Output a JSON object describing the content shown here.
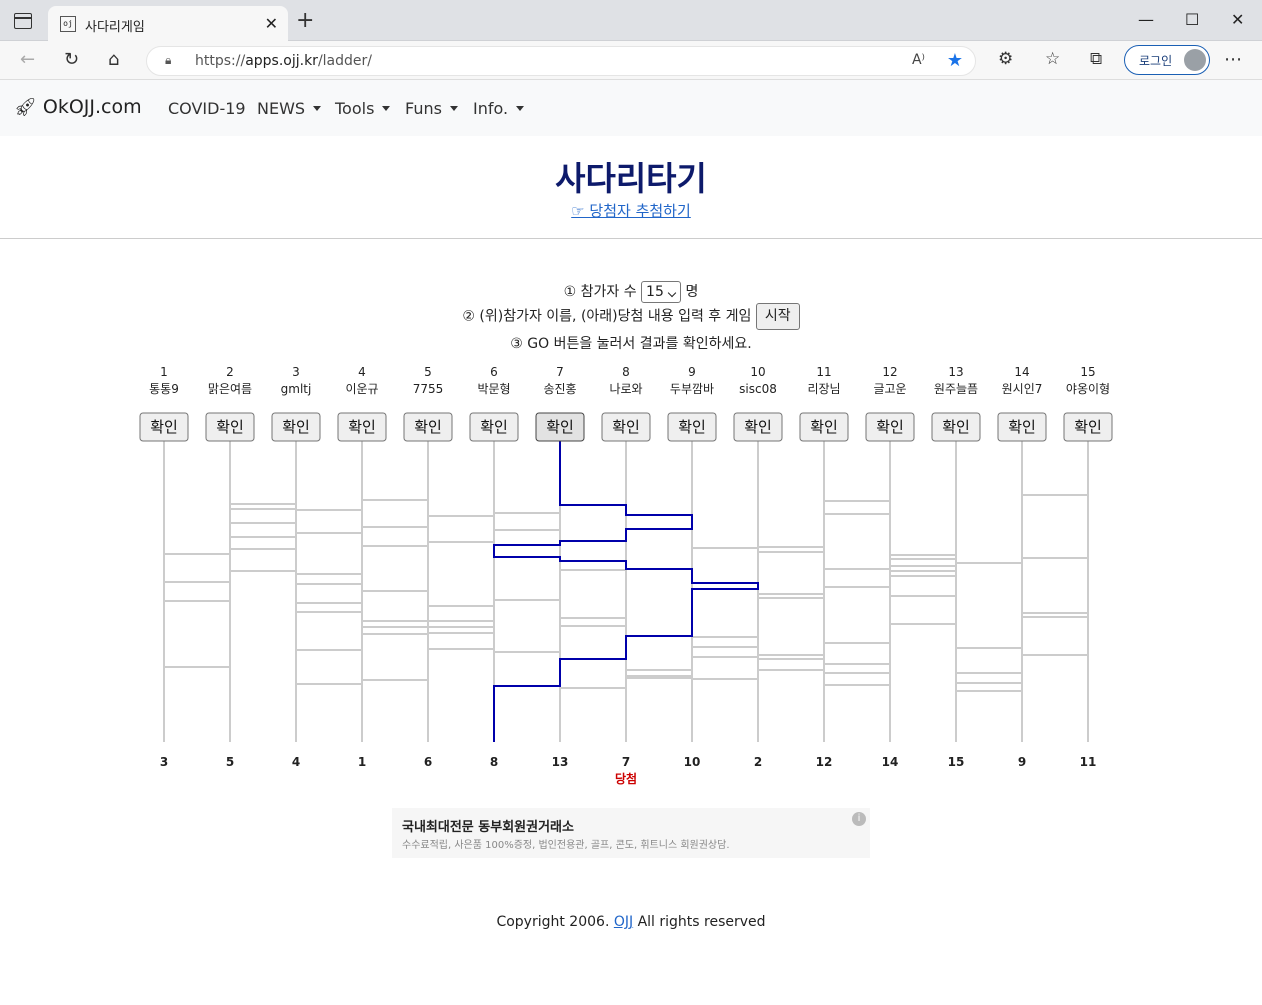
{
  "browser": {
    "tab_title": "사다리게임",
    "url_prefix": "https://",
    "url_host": "apps.ojj.kr",
    "url_path": "/ladder/",
    "login_label": "로그인"
  },
  "nav": {
    "brand": "OkOJJ.com",
    "items": [
      "COVID-19",
      "NEWS",
      "Tools",
      "Funs",
      "Info."
    ]
  },
  "header": {
    "title": "사다리타기",
    "draw_link": "☞ 당첨자 추첨하기"
  },
  "steps": {
    "step1_prefix": "① 참가자 수",
    "participant_count": "15",
    "step1_suffix": "명",
    "step2": "② (위)참가자 이름, (아래)당첨 내용 입력 후 게임",
    "start_label": "시작",
    "step3": "③ GO 버튼을 눌러서 결과를 확인하세요."
  },
  "players": [
    {
      "no": "1",
      "name": "통통9"
    },
    {
      "no": "2",
      "name": "맑은여름"
    },
    {
      "no": "3",
      "name": "gmltj"
    },
    {
      "no": "4",
      "name": "이운규"
    },
    {
      "no": "5",
      "name": "7755"
    },
    {
      "no": "6",
      "name": "박문형"
    },
    {
      "no": "7",
      "name": "송진홍"
    },
    {
      "no": "8",
      "name": "나로와"
    },
    {
      "no": "9",
      "name": "두부깜바"
    },
    {
      "no": "10",
      "name": "sisc08"
    },
    {
      "no": "11",
      "name": "리장님"
    },
    {
      "no": "12",
      "name": "글고운"
    },
    {
      "no": "13",
      "name": "원주늘픔"
    },
    {
      "no": "14",
      "name": "원시인7"
    },
    {
      "no": "15",
      "name": "야옹이형"
    }
  ],
  "confirm_label": "확인",
  "results": [
    "3",
    "5",
    "4",
    "1",
    "6",
    "8",
    "13",
    "7",
    "10",
    "2",
    "12",
    "14",
    "15",
    "9",
    "11"
  ],
  "winner_label": "당첨",
  "ladder": {
    "rungs": [
      [
        0,
        554
      ],
      [
        0,
        582
      ],
      [
        0,
        601
      ],
      [
        0,
        667
      ],
      [
        1,
        504
      ],
      [
        1,
        509
      ],
      [
        1,
        523
      ],
      [
        1,
        537
      ],
      [
        1,
        549
      ],
      [
        1,
        571
      ],
      [
        2,
        510
      ],
      [
        2,
        533
      ],
      [
        2,
        574
      ],
      [
        2,
        584
      ],
      [
        2,
        603
      ],
      [
        2,
        612
      ],
      [
        2,
        650
      ],
      [
        2,
        684
      ],
      [
        3,
        500
      ],
      [
        3,
        527
      ],
      [
        3,
        546
      ],
      [
        3,
        591
      ],
      [
        3,
        621
      ],
      [
        3,
        627
      ],
      [
        3,
        634
      ],
      [
        3,
        680
      ],
      [
        4,
        516
      ],
      [
        4,
        542
      ],
      [
        4,
        606
      ],
      [
        4,
        621
      ],
      [
        4,
        627
      ],
      [
        4,
        633
      ],
      [
        4,
        649
      ],
      [
        5,
        513
      ],
      [
        5,
        530
      ],
      [
        5,
        545
      ],
      [
        5,
        557
      ],
      [
        5,
        600
      ],
      [
        5,
        652
      ],
      [
        5,
        686
      ],
      [
        6,
        505
      ],
      [
        6,
        541
      ],
      [
        6,
        561
      ],
      [
        6,
        570
      ],
      [
        6,
        618
      ],
      [
        6,
        626
      ],
      [
        6,
        659
      ],
      [
        6,
        688
      ],
      [
        7,
        515
      ],
      [
        7,
        529
      ],
      [
        7,
        569
      ],
      [
        7,
        636
      ],
      [
        7,
        670
      ],
      [
        7,
        676
      ],
      [
        7,
        678
      ],
      [
        8,
        548
      ],
      [
        8,
        583
      ],
      [
        8,
        589
      ],
      [
        8,
        637
      ],
      [
        8,
        647
      ],
      [
        8,
        657
      ],
      [
        8,
        679
      ],
      [
        9,
        547
      ],
      [
        9,
        552
      ],
      [
        9,
        594
      ],
      [
        9,
        598
      ],
      [
        9,
        655
      ],
      [
        9,
        659
      ],
      [
        9,
        670
      ],
      [
        10,
        501
      ],
      [
        10,
        514
      ],
      [
        10,
        569
      ],
      [
        10,
        587
      ],
      [
        10,
        643
      ],
      [
        10,
        664
      ],
      [
        10,
        673
      ],
      [
        10,
        685
      ],
      [
        11,
        555
      ],
      [
        11,
        559
      ],
      [
        11,
        566
      ],
      [
        11,
        571
      ],
      [
        11,
        576
      ],
      [
        11,
        596
      ],
      [
        11,
        624
      ],
      [
        12,
        563
      ],
      [
        12,
        648
      ],
      [
        12,
        673
      ],
      [
        12,
        683
      ],
      [
        12,
        691
      ],
      [
        13,
        495
      ],
      [
        13,
        558
      ],
      [
        13,
        613
      ],
      [
        13,
        617
      ],
      [
        13,
        655
      ]
    ],
    "highlight_player": 7,
    "highlight_result": 8
  },
  "ad": {
    "title": "국내최대전문 동부회원권거래소",
    "desc": "수수료적립, 사은품 100%증정, 법인전용관, 골프, 콘도, 휘트니스 회원권상담."
  },
  "footer": {
    "prefix": "Copyright 2006.",
    "link": "OJJ",
    "suffix": "All rights reserved"
  },
  "colors": {
    "highlight": "#0000aa",
    "rail": "#cccccc",
    "winner": "#cc0000"
  }
}
